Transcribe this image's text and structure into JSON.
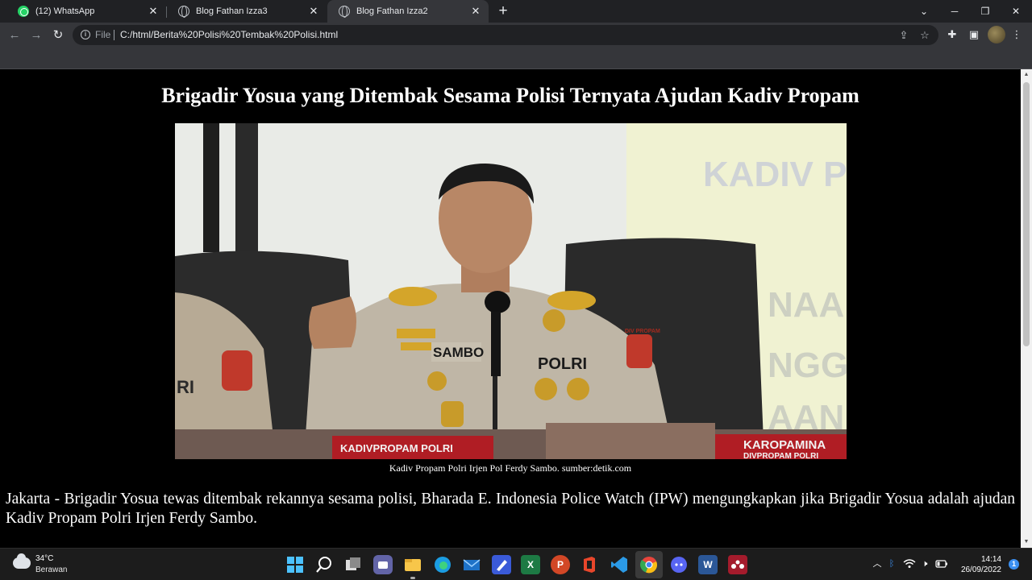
{
  "browser": {
    "tabs": [
      {
        "title": "(12) WhatsApp",
        "icon": "whatsapp-icon",
        "active": false
      },
      {
        "title": "Blog Fathan Izza3",
        "icon": "globe-icon",
        "active": false
      },
      {
        "title": "Blog Fathan Izza2",
        "icon": "globe-icon",
        "active": true
      }
    ],
    "address": {
      "scheme_label": "File",
      "url": "C:/html/Berita%20Polisi%20Tembak%20Polisi.html"
    }
  },
  "page": {
    "headline": "Brigadir Yosua yang Ditembak Sesama Polisi Ternyata Ajudan Kadiv Propam",
    "photo": {
      "backdrop_text": [
        "KADIV PR",
        "NAAN",
        "NGGA",
        "AAN M"
      ],
      "uniform_labels": {
        "name_tape": "SAMBO",
        "chest": "POLRI",
        "left_officer": "RI",
        "right_badge": "DIV PROPAM"
      },
      "placards": {
        "center": "KADIVPROPAM POLRI",
        "right": "KAROPAMINA",
        "right_sub": "DIVPROPAM POLRI"
      }
    },
    "caption": "Kadiv Propam Polri Irjen Pol Ferdy Sambo. sumber:detik.com",
    "body": "Jakarta - Brigadir Yosua tewas ditembak rekannya sesama polisi, Bharada E. Indonesia Police Watch (IPW) mengungkapkan jika Brigadir Yosua adalah ajudan Kadiv Propam Polri Irjen Ferdy Sambo."
  },
  "taskbar": {
    "weather": {
      "temp": "34°C",
      "desc": "Berawan"
    },
    "clock": {
      "time": "14:14",
      "date": "26/09/2022"
    },
    "notification_count": "1",
    "apps": [
      {
        "name": "start-button",
        "glyph": ""
      },
      {
        "name": "search-button",
        "glyph": ""
      },
      {
        "name": "task-view-button",
        "glyph": ""
      },
      {
        "name": "teams-chat-app",
        "glyph": ""
      },
      {
        "name": "file-explorer-app",
        "glyph": ""
      },
      {
        "name": "edge-app",
        "glyph": ""
      },
      {
        "name": "mail-app",
        "glyph": ""
      },
      {
        "name": "pen-app",
        "glyph": ""
      },
      {
        "name": "excel-app",
        "glyph": "X"
      },
      {
        "name": "powerpoint-app",
        "glyph": "P"
      },
      {
        "name": "office-app",
        "glyph": ""
      },
      {
        "name": "vscode-app",
        "glyph": ""
      },
      {
        "name": "chrome-app",
        "glyph": ""
      },
      {
        "name": "discord-app",
        "glyph": ""
      },
      {
        "name": "word-app",
        "glyph": "W"
      },
      {
        "name": "mendeley-app",
        "glyph": ""
      }
    ]
  },
  "colors": {
    "page_bg": "#000000",
    "page_text": "#ffffff",
    "chrome_dark": "#202124",
    "chrome_toolbar": "#35363a",
    "taskbar": "#1c1c1c"
  }
}
